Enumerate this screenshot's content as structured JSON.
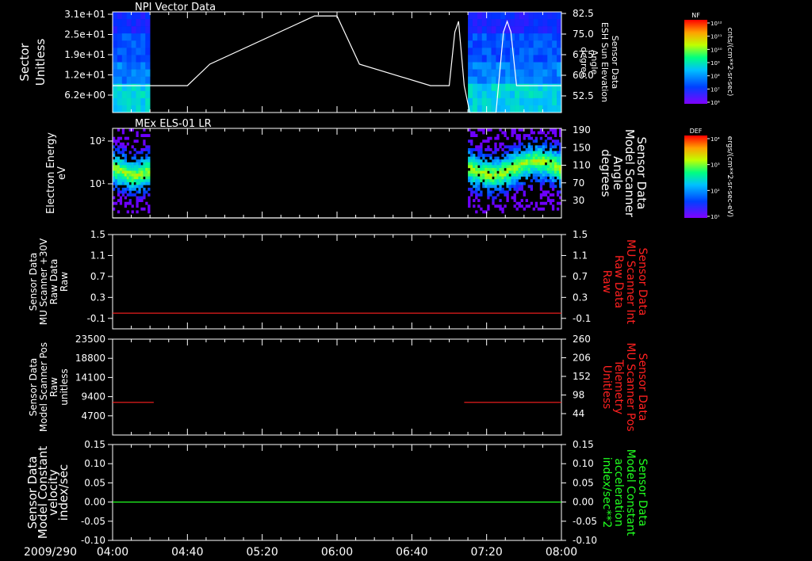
{
  "date_label": "2009/290",
  "time_ticks": [
    "04:00",
    "04:40",
    "05:20",
    "06:00",
    "06:40",
    "07:20",
    "08:00"
  ],
  "colorbars": [
    {
      "title": "NF",
      "unit": "cnts/(cm**2-sr-sec)",
      "ticks": [
        "10¹²",
        "10¹¹",
        "10¹⁰",
        "10⁹",
        "10⁸",
        "10⁷",
        "10⁶"
      ]
    },
    {
      "title": "DEF",
      "unit": "ergs/(cm**2-sr-sec-eV)",
      "ticks": [
        "10⁴",
        "10³",
        "10²",
        "10¹"
      ]
    }
  ],
  "chart_data": [
    {
      "type": "heatmap",
      "title": "NPI Vector Data",
      "ylabel_left": [
        "Sector",
        "Unitless"
      ],
      "yticks_left": [
        "3.1e+01",
        "2.5e+01",
        "1.9e+01",
        "1.2e+01",
        "6.2e+00"
      ],
      "ylabel_right": [
        "Sensor Data",
        "ESH Sun Elevation",
        "Angle",
        "degree"
      ],
      "yticks_right": [
        "82.5",
        "75.0",
        "67.5",
        "60.0",
        "52.5"
      ],
      "ylim_right": [
        45,
        82.5
      ],
      "data_intervals": [
        [
          "04:00",
          "04:20"
        ],
        [
          "07:10",
          "08:00"
        ]
      ],
      "line_series": {
        "name": "Sensor Data ESH Sun Elevation Angle",
        "color": "#ffffff",
        "t": [
          "04:00",
          "04:28",
          "04:40",
          "04:52",
          "05:48",
          "06:00",
          "06:12",
          "06:50",
          "07:00",
          "07:03",
          "07:05",
          "07:08",
          "07:11",
          "07:15",
          "07:20",
          "07:25",
          "07:29",
          "07:31",
          "07:33",
          "07:36",
          "07:39",
          "07:43",
          "08:00"
        ],
        "v": [
          55,
          55,
          55,
          63,
          81,
          81,
          63,
          55,
          55,
          75,
          79,
          55,
          45,
          45,
          45,
          45,
          75,
          79,
          75,
          55,
          55,
          55,
          55
        ]
      }
    },
    {
      "type": "heatmap",
      "title": "MEx ELS-01 LR",
      "ylabel_left": [
        "Electron Energy",
        "eV"
      ],
      "yticks_left": [
        "10²",
        "10¹"
      ],
      "ylabel_right": [
        "Sensor Data",
        "Model Scanner",
        "Angle",
        "degrees"
      ],
      "yticks_right": [
        "190",
        "150",
        "110",
        "70",
        "30"
      ],
      "ylim_right": [
        10,
        190
      ],
      "data_intervals": [
        [
          "04:00",
          "04:20"
        ],
        [
          "07:10",
          "08:00"
        ]
      ],
      "line_series": {
        "name": "Sensor Data Model Scanner Angle",
        "color": "#ffffff",
        "t": [
          "04:00",
          "08:00"
        ],
        "v": [
          10,
          10
        ]
      }
    },
    {
      "type": "line",
      "ylabel_left": [
        "Sensor Data",
        "MU Scanner +30V",
        "Raw Data",
        "Raw"
      ],
      "yticks_left": [
        "1.5",
        "1.1",
        "0.7",
        "0.3",
        "-0.1"
      ],
      "ylim": [
        -0.3,
        1.5
      ],
      "ylabel_right": [
        "Sensor Data",
        "MU Scanner Int",
        "Raw Data",
        "Raw"
      ],
      "yticks_right": [
        "1.5",
        "1.1",
        "0.7",
        "0.3",
        "-0.1"
      ],
      "series": [
        {
          "color": "#ff2020",
          "segments": [
            {
              "t": [
                "04:00",
                "08:00"
              ],
              "v": [
                0,
                0
              ]
            }
          ]
        }
      ]
    },
    {
      "type": "line",
      "ylabel_left": [
        "Sensor Data",
        "Model Scanner Pos",
        "Raw",
        "unitless"
      ],
      "yticks_left": [
        "23500",
        "18800",
        "14100",
        "9400",
        "4700"
      ],
      "ylim": [
        0,
        23500
      ],
      "ylabel_right": [
        "Sensor Data",
        "MU Scanner Pos",
        "Telemetry",
        "Unitless"
      ],
      "yticks_right": [
        "260",
        "206",
        "152",
        "98",
        "44"
      ],
      "series": [
        {
          "color": "#ff2020",
          "segments": [
            {
              "t": [
                "04:00",
                "04:22"
              ],
              "v": [
                8000,
                8000
              ]
            },
            {
              "t": [
                "07:08",
                "08:00"
              ],
              "v": [
                8000,
                8000
              ]
            }
          ]
        }
      ]
    },
    {
      "type": "line",
      "ylabel_left": [
        "Sensor Data",
        "Model Constant",
        "velocity",
        "index/sec"
      ],
      "yticks_left": [
        "0.15",
        "0.10",
        "0.05",
        "0.00",
        "-0.05",
        "-0.10"
      ],
      "ylim": [
        -0.1,
        0.15
      ],
      "ylabel_right": [
        "Sensor Data",
        "Model Constant",
        "acceleration",
        "index/sec**2"
      ],
      "yticks_right": [
        "0.15",
        "0.10",
        "0.05",
        "0.00",
        "-0.05",
        "-0.10"
      ],
      "series": [
        {
          "color": "#20ff20",
          "segments": [
            {
              "t": [
                "04:00",
                "08:00"
              ],
              "v": [
                0,
                0
              ]
            }
          ]
        }
      ]
    }
  ],
  "colors": {
    "axis": "#ffffff",
    "red_label": "#ff2020",
    "green_label": "#20ff20"
  }
}
